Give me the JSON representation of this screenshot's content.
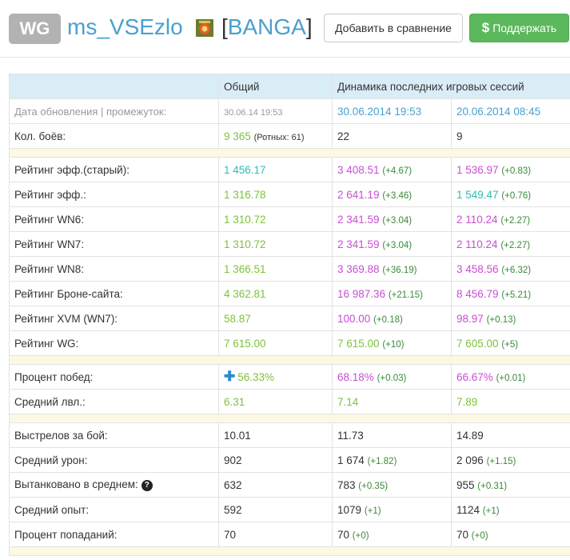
{
  "header": {
    "badge": "WG",
    "nickname": "ms_VSEzlo",
    "clan_tag_open": "[",
    "clan_tag": "BANGA",
    "clan_tag_close": "]",
    "compare_button": "Добавить в сравнение",
    "support_icon": "$",
    "support_button": "Поддержать"
  },
  "table": {
    "headers": {
      "first": "",
      "overall": "Общий",
      "dynamics": "Динамика последних игровых сессий"
    },
    "date_row": {
      "label": "Дата обновления | промежуток:",
      "overall": "30.06.14 19:53",
      "s1": "30.06.2014 19:53",
      "s2": "20.06.2014 08:45"
    },
    "battles_row": {
      "label": "Кол. боёв:",
      "overall": "9 365",
      "overall_extra": "(Ротных: 61)",
      "s1": "22",
      "s2": "9"
    },
    "rating_rows": [
      {
        "label": "Рейтинг эфф.(старый):",
        "overall": "1 456.17",
        "overall_color": "teal",
        "s1": "3 408.51",
        "s1_color": "purple",
        "s1_delta": "(+4.67)",
        "s2": "1 536.97",
        "s2_color": "purple",
        "s2_delta": "(+0.83)"
      },
      {
        "label": "Рейтинг эфф.:",
        "overall": "1 316.78",
        "overall_color": "green",
        "s1": "2 641.19",
        "s1_color": "purple",
        "s1_delta": "(+3.46)",
        "s2": "1 549.47",
        "s2_color": "teal",
        "s2_delta": "(+0.76)"
      },
      {
        "label": "Рейтинг WN6:",
        "overall": "1 310.72",
        "overall_color": "green",
        "s1": "2 341.59",
        "s1_color": "purple",
        "s1_delta": "(+3.04)",
        "s2": "2 110.24",
        "s2_color": "purple",
        "s2_delta": "(+2.27)"
      },
      {
        "label": "Рейтинг WN7:",
        "overall": "1 310.72",
        "overall_color": "green",
        "s1": "2 341.59",
        "s1_color": "purple",
        "s1_delta": "(+3.04)",
        "s2": "2 110.24",
        "s2_color": "purple",
        "s2_delta": "(+2.27)"
      },
      {
        "label": "Рейтинг WN8:",
        "overall": "1 366.51",
        "overall_color": "green",
        "s1": "3 369.88",
        "s1_color": "purple",
        "s1_delta": "(+36.19)",
        "s2": "3 458.56",
        "s2_color": "purple",
        "s2_delta": "(+6.32)"
      },
      {
        "label": "Рейтинг Броне-сайта:",
        "overall": "4 362.81",
        "overall_color": "green",
        "s1": "16 987.36",
        "s1_color": "purple",
        "s1_delta": "(+21.15)",
        "s2": "8 456.79",
        "s2_color": "purple",
        "s2_delta": "(+5.21)"
      },
      {
        "label": "Рейтинг XVM (WN7):",
        "overall": "58.87",
        "overall_color": "green",
        "s1": "100.00",
        "s1_color": "purple",
        "s1_delta": "(+0.18)",
        "s2": "98.97",
        "s2_color": "purple",
        "s2_delta": "(+0.13)"
      },
      {
        "label": "Рейтинг WG:",
        "overall": "7 615.00",
        "overall_color": "green",
        "s1": "7 615.00",
        "s1_color": "green",
        "s1_delta": "(+10)",
        "s2": "7 605.00",
        "s2_color": "green",
        "s2_delta": "(+5)"
      }
    ],
    "win_rows": [
      {
        "label": "Процент побед:",
        "overall": "56.33%",
        "overall_color": "green",
        "overall_icon": "plus-icon",
        "s1": "68.18%",
        "s1_color": "purple",
        "s1_delta": "(+0.03)",
        "s2": "66.67%",
        "s2_color": "purple",
        "s2_delta": "(+0.01)"
      },
      {
        "label": "Средний лвл.:",
        "overall": "6.31",
        "overall_color": "green",
        "s1": "7.14",
        "s1_color": "green",
        "s1_delta": "",
        "s2": "7.89",
        "s2_color": "green",
        "s2_delta": ""
      }
    ],
    "combat_rows": [
      {
        "label": "Выстрелов за бой:",
        "overall": "10.01",
        "s1": "11.73",
        "s1_delta": "",
        "s2": "14.89",
        "s2_delta": ""
      },
      {
        "label": "Средний урон:",
        "overall": "902",
        "s1": "1 674",
        "s1_delta": "(+1.82)",
        "s2": "2 096",
        "s2_delta": "(+1.15)"
      },
      {
        "label": "Вытанковано в среднем:",
        "has_help": true,
        "help_icon": "?",
        "overall": "632",
        "s1": "783",
        "s1_delta": "(+0.35)",
        "s2": "955",
        "s2_delta": "(+0.31)"
      },
      {
        "label": "Средний опыт:",
        "overall": "592",
        "s1": "1079",
        "s1_delta": "(+1)",
        "s2": "1124",
        "s2_delta": "(+1)"
      },
      {
        "label": "Процент попаданий:",
        "overall": "70",
        "s1": "70",
        "s1_delta": "(+0)",
        "s2": "70",
        "s2_delta": "(+0)"
      }
    ]
  }
}
